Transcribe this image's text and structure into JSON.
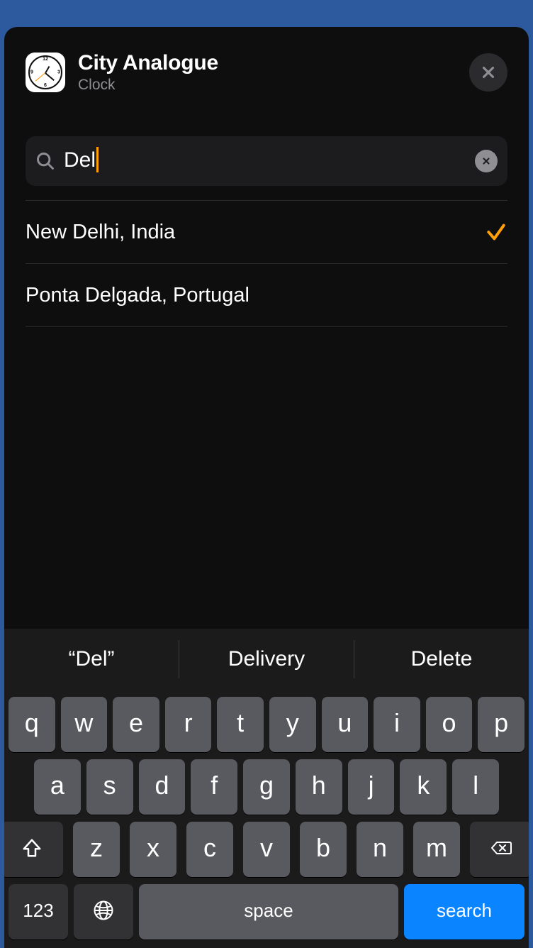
{
  "header": {
    "title": "City Analogue",
    "subtitle": "Clock"
  },
  "search": {
    "value": "Del"
  },
  "results": [
    {
      "label": "New Delhi, India",
      "selected": true
    },
    {
      "label": "Ponta Delgada, Portugal",
      "selected": false
    }
  ],
  "suggestions": [
    "“Del”",
    "Delivery",
    "Delete"
  ],
  "keyboard": {
    "row1": [
      "q",
      "w",
      "e",
      "r",
      "t",
      "y",
      "u",
      "i",
      "o",
      "p"
    ],
    "row2": [
      "a",
      "s",
      "d",
      "f",
      "g",
      "h",
      "j",
      "k",
      "l"
    ],
    "row3": [
      "z",
      "x",
      "c",
      "v",
      "b",
      "n",
      "m"
    ],
    "numbers_label": "123",
    "space_label": "space",
    "search_label": "search"
  }
}
